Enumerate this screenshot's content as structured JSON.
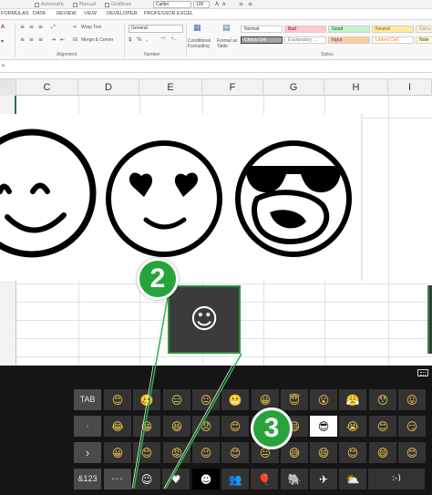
{
  "ribbon": {
    "checkboxes": [
      "Automatic",
      "Manual",
      "Gridlines"
    ],
    "font_name": "Calibri",
    "font_size": "100",
    "tabs": [
      "FORMULAS",
      "DATA",
      "REVIEW",
      "VIEW",
      "DEVELOPER",
      "PROFESSOR EXCEL"
    ],
    "wrap_text": "Wrap Text",
    "merge_center": "Merge & Center",
    "number_format": "General",
    "conditional_formatting": "Conditional Formatting",
    "format_as_table": "Format as Table",
    "groups": {
      "alignment": "Alignment",
      "number": "Number",
      "styles": "Styles"
    },
    "cell_styles": {
      "row1": [
        "Normal",
        "Bad",
        "Good",
        "Neutral",
        "Calcu"
      ],
      "row2": [
        "Check Cell",
        "Explanatory ...",
        "Input",
        "Linked Cell",
        "Note"
      ]
    }
  },
  "sheet": {
    "columns": [
      "C",
      "D",
      "E",
      "F",
      "G",
      "H",
      "I"
    ]
  },
  "callout": {
    "glyph": "☺"
  },
  "keyboard": {
    "function_keys": {
      "tab": "TAB",
      "back": "‹",
      "forward": "›",
      "numbers": "&123",
      "dots": "●●●"
    },
    "rows": [
      [
        "😊",
        "🥴",
        "😑",
        "😐",
        "😬",
        "😀",
        "😇",
        "😮",
        "😤",
        "😯",
        "😛"
      ],
      [
        "😂",
        "😁",
        "😆",
        "😞",
        "😊",
        "😃",
        "😄",
        "😎",
        "😭",
        "😊",
        "😏"
      ],
      [
        "😀",
        "😊",
        "😡",
        "😉",
        "😊",
        "😐",
        "😅",
        "😄",
        "😊",
        "😄",
        "😊"
      ]
    ],
    "highlighted_key": "😎",
    "categories": [
      "☺",
      "♥",
      "☻",
      "👥",
      "🎈",
      "🐘",
      "✈",
      "⛅",
      ":-)"
    ],
    "colors": {
      "background": "#151515",
      "key": "#333333",
      "function_key": "#4a4a4a"
    }
  },
  "badges": [
    "2",
    "3"
  ],
  "colors": {
    "badge": "#27a33b",
    "accent_green": "#217346"
  }
}
